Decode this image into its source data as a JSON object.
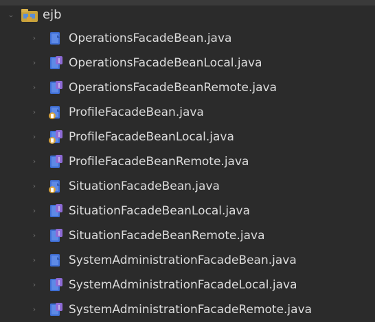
{
  "package": {
    "name": "ejb",
    "icon": "package-folder-icon",
    "expanded": true
  },
  "files": [
    {
      "name": "OperationsFacadeBean.java",
      "kind": "class"
    },
    {
      "name": "OperationsFacadeBeanLocal.java",
      "kind": "interface"
    },
    {
      "name": "OperationsFacadeBeanRemote.java",
      "kind": "interface"
    },
    {
      "name": "ProfileFacadeBean.java",
      "kind": "class-modified"
    },
    {
      "name": "ProfileFacadeBeanLocal.java",
      "kind": "interface-modified"
    },
    {
      "name": "ProfileFacadeBeanRemote.java",
      "kind": "interface"
    },
    {
      "name": "SituationFacadeBean.java",
      "kind": "class-modified"
    },
    {
      "name": "SituationFacadeBeanLocal.java",
      "kind": "interface"
    },
    {
      "name": "SituationFacadeBeanRemote.java",
      "kind": "interface"
    },
    {
      "name": "SystemAdministrationFacadeBean.java",
      "kind": "class"
    },
    {
      "name": "SystemAdministrationFacadeLocal.java",
      "kind": "interface"
    },
    {
      "name": "SystemAdministrationFacadeRemote.java",
      "kind": "interface"
    }
  ],
  "colors": {
    "background": "#2b2b2b",
    "text": "#dcdcdc",
    "twisty": "#6f6f6f",
    "java_file_blue": "#3f6fd6",
    "interface_badge": "#8e6bd6",
    "modified_badge": "#d7a23a"
  }
}
